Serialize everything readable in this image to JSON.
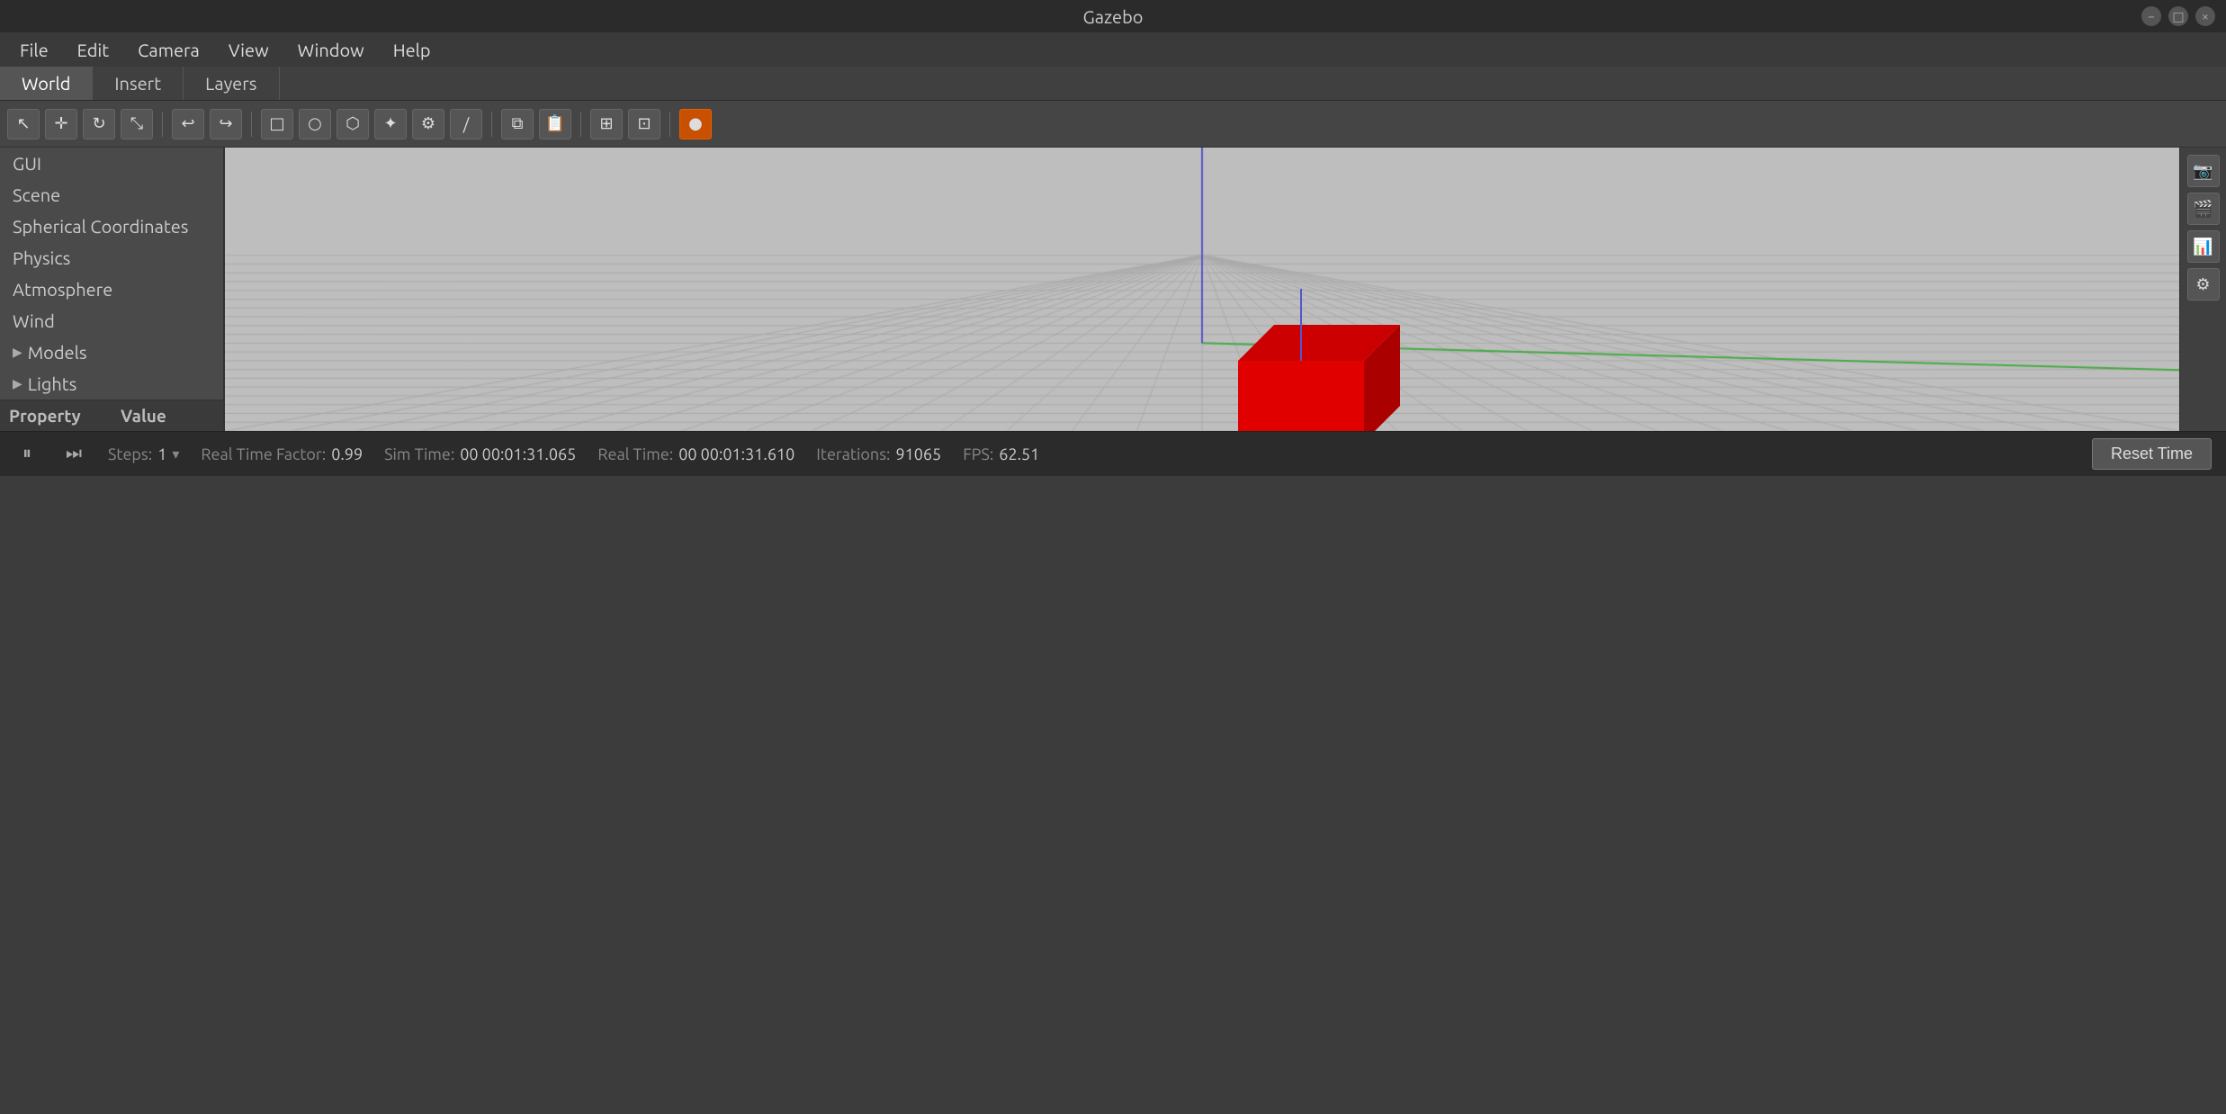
{
  "titlebar": {
    "title": "Gazebo",
    "controls": [
      "−",
      "□",
      "×"
    ]
  },
  "menubar": {
    "items": [
      "File",
      "Edit",
      "Camera",
      "View",
      "Window",
      "Help"
    ]
  },
  "tabs": {
    "items": [
      "World",
      "Insert",
      "Layers"
    ],
    "active": 0
  },
  "toolbar": {
    "buttons": [
      {
        "name": "select-tool",
        "icon": "↖",
        "tooltip": "Select"
      },
      {
        "name": "translate-tool",
        "icon": "✛",
        "tooltip": "Translate"
      },
      {
        "name": "rotate-tool",
        "icon": "↻",
        "tooltip": "Rotate"
      },
      {
        "name": "scale-tool",
        "icon": "⤡",
        "tooltip": "Scale"
      },
      {
        "name": "sep1",
        "type": "sep"
      },
      {
        "name": "undo",
        "icon": "↩",
        "tooltip": "Undo"
      },
      {
        "name": "redo",
        "icon": "↪",
        "tooltip": "Redo"
      },
      {
        "name": "sep2",
        "type": "sep"
      },
      {
        "name": "box",
        "icon": "□",
        "tooltip": "Box"
      },
      {
        "name": "sphere",
        "icon": "○",
        "tooltip": "Sphere"
      },
      {
        "name": "cylinder",
        "icon": "⬡",
        "tooltip": "Cylinder"
      },
      {
        "name": "point-light",
        "icon": "✦",
        "tooltip": "Point Light"
      },
      {
        "name": "spot-light",
        "icon": "⚙",
        "tooltip": "Spot Light"
      },
      {
        "name": "directional-light",
        "icon": "/",
        "tooltip": "Directional Light"
      },
      {
        "name": "sep3",
        "type": "sep"
      },
      {
        "name": "copy",
        "icon": "⧉",
        "tooltip": "Copy"
      },
      {
        "name": "paste",
        "icon": "📋",
        "tooltip": "Paste"
      },
      {
        "name": "sep4",
        "type": "sep"
      },
      {
        "name": "align",
        "icon": "⊞",
        "tooltip": "Align"
      },
      {
        "name": "snap",
        "icon": "⊡",
        "tooltip": "Snap"
      },
      {
        "name": "sep5",
        "type": "sep"
      },
      {
        "name": "record",
        "icon": "🔴",
        "tooltip": "Record"
      }
    ]
  },
  "sidebar": {
    "items": [
      {
        "label": "GUI",
        "expandable": false
      },
      {
        "label": "Scene",
        "expandable": false
      },
      {
        "label": "Spherical Coordinates",
        "expandable": false
      },
      {
        "label": "Physics",
        "expandable": false
      },
      {
        "label": "Atmosphere",
        "expandable": false
      },
      {
        "label": "Wind",
        "expandable": false
      },
      {
        "label": "Models",
        "expandable": true
      },
      {
        "label": "Lights",
        "expandable": true
      }
    ]
  },
  "properties": {
    "col1": "Property",
    "col2": "Value"
  },
  "viewport": {
    "background": "#bebebe"
  },
  "statusbar": {
    "pause_icon": "⏸",
    "step_icon": "⏭",
    "steps_label": "Steps:",
    "steps_value": "1",
    "realtime_factor_label": "Real Time Factor:",
    "realtime_factor_value": "0.99",
    "sim_time_label": "Sim Time:",
    "sim_time_value": "00 00:01:31.065",
    "real_time_label": "Real Time:",
    "real_time_value": "00 00:01:31.610",
    "iterations_label": "Iterations:",
    "iterations_value": "91065",
    "fps_label": "FPS:",
    "fps_value": "62.51",
    "reset_btn": "Reset Time"
  },
  "right_panel": {
    "buttons": [
      "📷",
      "🎥",
      "📈",
      "⚙"
    ]
  }
}
